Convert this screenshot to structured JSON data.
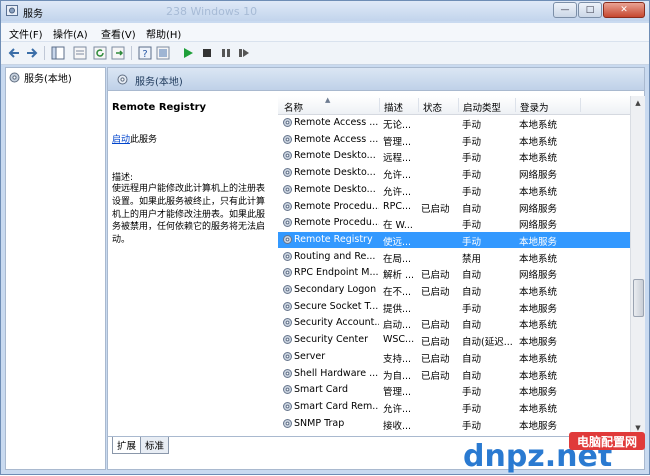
{
  "window": {
    "title": "服务",
    "faded_title": "238 Windows 10",
    "min": "—",
    "max": "□",
    "close": "✕"
  },
  "menu": [
    "文件(F)",
    "操作(A)",
    "查看(V)",
    "帮助(H)"
  ],
  "toolbar": {
    "icons": [
      "back-icon",
      "forward-icon",
      "up-icon",
      "show-hide-tree-icon",
      "refresh-icon",
      "export-icon",
      "help-icon",
      "properties-icon",
      "play-icon",
      "stop-icon",
      "pause-icon",
      "restart-icon"
    ]
  },
  "tree": {
    "label": "服务(本地)"
  },
  "panel": {
    "header": "服务(本地)",
    "service_name": "Remote Registry",
    "start_link": "启动",
    "start_suffix": "此服务",
    "desc_label": "描述:",
    "desc_text": "使远程用户能修改此计算机上的注册表设置。如果此服务被终止，只有此计算机上的用户才能修改注册表。如果此服务被禁用，任何依赖它的服务将无法启动。"
  },
  "columns": {
    "name": "名称",
    "desc": "描述",
    "status": "状态",
    "start": "启动类型",
    "logon": "登录为"
  },
  "rows": [
    {
      "name": "Remote Access ...",
      "desc": "无论...",
      "status": "",
      "start": "手动",
      "logon": "本地系统"
    },
    {
      "name": "Remote Access ...",
      "desc": "管理...",
      "status": "",
      "start": "手动",
      "logon": "本地系统"
    },
    {
      "name": "Remote Deskto...",
      "desc": "远程...",
      "status": "",
      "start": "手动",
      "logon": "本地系统"
    },
    {
      "name": "Remote Deskto...",
      "desc": "允许...",
      "status": "",
      "start": "手动",
      "logon": "网络服务"
    },
    {
      "name": "Remote Deskto...",
      "desc": "允许...",
      "status": "",
      "start": "手动",
      "logon": "本地系统"
    },
    {
      "name": "Remote Procedu...",
      "desc": "RPC...",
      "status": "已启动",
      "start": "自动",
      "logon": "网络服务"
    },
    {
      "name": "Remote Procedu...",
      "desc": "在 W...",
      "status": "",
      "start": "手动",
      "logon": "网络服务"
    },
    {
      "name": "Remote Registry",
      "desc": "使远...",
      "status": "",
      "start": "手动",
      "logon": "本地服务",
      "selected": true
    },
    {
      "name": "Routing and Re...",
      "desc": "在局...",
      "status": "",
      "start": "禁用",
      "logon": "本地系统"
    },
    {
      "name": "RPC Endpoint M...",
      "desc": "解析 ...",
      "status": "已启动",
      "start": "自动",
      "logon": "网络服务"
    },
    {
      "name": "Secondary Logon",
      "desc": "在不...",
      "status": "已启动",
      "start": "自动",
      "logon": "本地系统"
    },
    {
      "name": "Secure Socket T...",
      "desc": "提供...",
      "status": "",
      "start": "手动",
      "logon": "本地服务"
    },
    {
      "name": "Security Account...",
      "desc": "启动...",
      "status": "已启动",
      "start": "自动",
      "logon": "本地系统"
    },
    {
      "name": "Security Center",
      "desc": "WSC...",
      "status": "已启动",
      "start": "自动(延迟...",
      "logon": "本地服务"
    },
    {
      "name": "Server",
      "desc": "支持...",
      "status": "已启动",
      "start": "自动",
      "logon": "本地系统"
    },
    {
      "name": "Shell Hardware ...",
      "desc": "为自...",
      "status": "已启动",
      "start": "自动",
      "logon": "本地系统"
    },
    {
      "name": "Smart Card",
      "desc": "管理...",
      "status": "",
      "start": "手动",
      "logon": "本地服务"
    },
    {
      "name": "Smart Card Rem...",
      "desc": "允许...",
      "status": "",
      "start": "手动",
      "logon": "本地系统"
    },
    {
      "name": "SNMP Trap",
      "desc": "接收...",
      "status": "",
      "start": "手动",
      "logon": "本地服务"
    }
  ],
  "tabs": [
    "扩展",
    "标准"
  ],
  "watermark": {
    "brand": "dnpz.net",
    "cn": "电脑配置网"
  },
  "colors": {
    "selection": "#3399ff",
    "link": "#0044cc",
    "title_bar": "#c2d4ec"
  }
}
